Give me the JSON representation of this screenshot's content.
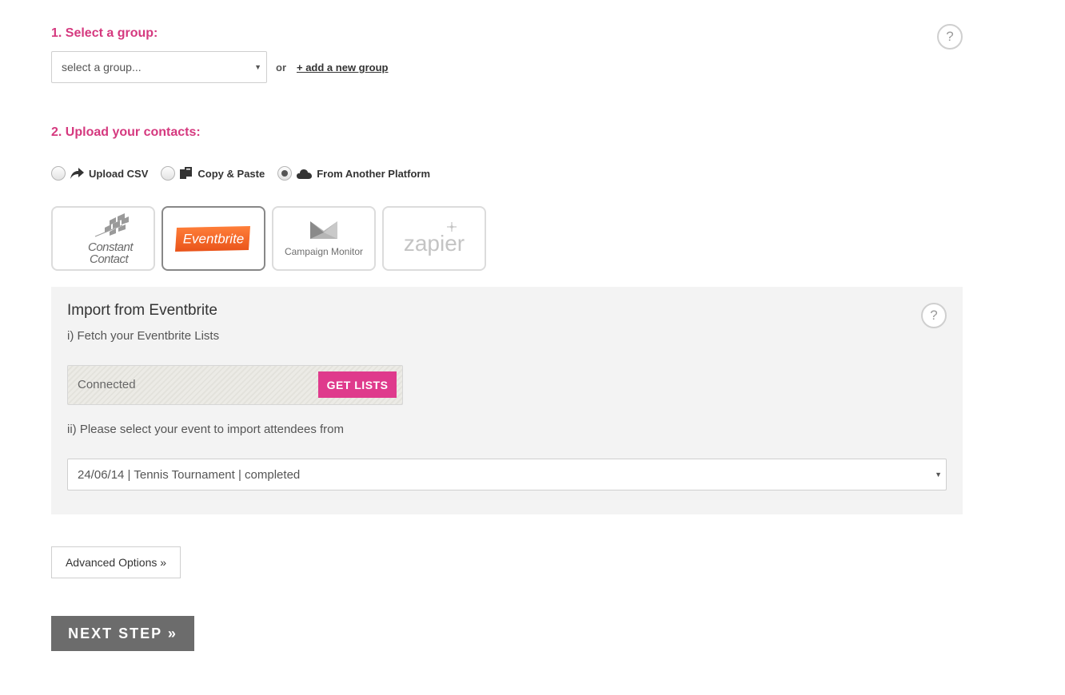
{
  "step1": {
    "title": "1. Select a group:",
    "group_select_value": "select a group...",
    "or_label": "or",
    "add_group_link": "+ add a new group"
  },
  "help_icon": "?",
  "step2": {
    "title": "2. Upload your contacts:",
    "options": [
      {
        "label": "Upload CSV",
        "icon": "share-arrow-icon",
        "selected": false
      },
      {
        "label": "Copy & Paste",
        "icon": "copy-paste-icon",
        "selected": false
      },
      {
        "label": "From Another Platform",
        "icon": "cloud-icon",
        "selected": true
      }
    ]
  },
  "platforms": [
    {
      "name": "Constant Contact",
      "line1": "Constant",
      "line2": "Contact",
      "active": false
    },
    {
      "name": "Eventbrite",
      "active": true
    },
    {
      "name": "Campaign Monitor",
      "active": false
    },
    {
      "name": "zapier",
      "active": false
    }
  ],
  "import_panel": {
    "title": "Import from Eventbrite",
    "fetch_label": "i) Fetch your Eventbrite Lists",
    "connected_text": "Connected",
    "get_lists_button": "GET LISTS",
    "select_event_label": "ii) Please select your event to import attendees from",
    "event_select_value": "24/06/14 | Tennis Tournament | completed"
  },
  "advanced_options_button": "Advanced Options »",
  "next_step_button": "NEXT STEP »",
  "colors": {
    "accent_pink": "#df3a8c",
    "heading_pink": "#d5397f",
    "next_button_gray": "#6c6c6c",
    "eventbrite_orange": "#f6682f"
  }
}
